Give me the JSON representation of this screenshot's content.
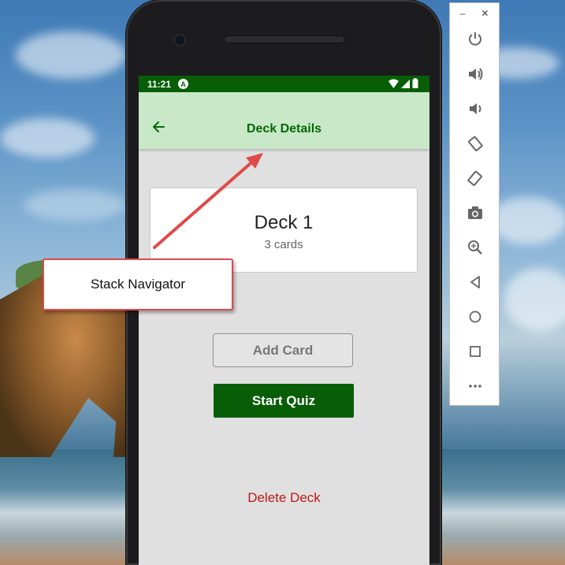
{
  "status_bar": {
    "time": "11:21",
    "notification_glyph": "A"
  },
  "header": {
    "title": "Deck Details",
    "back_icon": "arrow-left-icon"
  },
  "deck": {
    "title": "Deck 1",
    "count": "3 cards"
  },
  "actions": {
    "add_card": "Add Card",
    "start_quiz": "Start Quiz",
    "delete_deck": "Delete Deck"
  },
  "annotation": {
    "label": "Stack Navigator"
  },
  "emulator_panel": {
    "window_controls": [
      "minimize-icon",
      "close-icon"
    ],
    "tools": [
      "power-icon",
      "volume-up-icon",
      "volume-down-icon",
      "rotate-left-icon",
      "rotate-right-icon",
      "camera-icon",
      "zoom-icon",
      "back-triangle-icon",
      "home-circle-icon",
      "overview-square-icon",
      "more-icon"
    ]
  },
  "colors": {
    "accent_green": "#075e07",
    "header_bg": "#c8e8c8",
    "danger_red": "#c01818",
    "callout_border": "#e04a4a"
  }
}
